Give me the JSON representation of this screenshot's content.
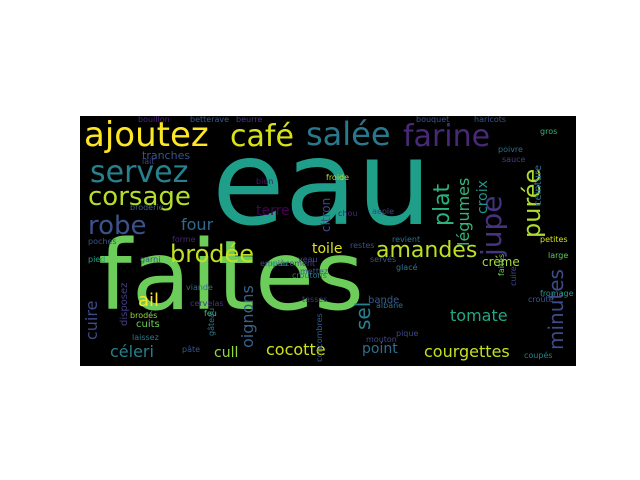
{
  "wordcloud": {
    "words": [
      {
        "text": "eau",
        "color": "#1f9e89"
      },
      {
        "text": "faites",
        "color": "#6ccd5a"
      },
      {
        "text": "ajoutez",
        "color": "#fde725"
      },
      {
        "text": "café",
        "color": "#d8e219"
      },
      {
        "text": "salée",
        "color": "#2a788e"
      },
      {
        "text": "farine",
        "color": "#482878"
      },
      {
        "text": "servez",
        "color": "#26828e"
      },
      {
        "text": "corsage",
        "color": "#b5de2b"
      },
      {
        "text": "robe",
        "color": "#3b528b"
      },
      {
        "text": "brodée",
        "color": "#c2df23"
      },
      {
        "text": "four",
        "color": "#31688e"
      },
      {
        "text": "amandes",
        "color": "#bddf26"
      },
      {
        "text": "purée",
        "color": "#addc30"
      },
      {
        "text": "jupe",
        "color": "#46327e"
      },
      {
        "text": "plat",
        "color": "#2db27d"
      },
      {
        "text": "légumes",
        "color": "#35b779"
      },
      {
        "text": "minutes",
        "color": "#3e4a89"
      },
      {
        "text": "sel",
        "color": "#26828e"
      },
      {
        "text": "terre",
        "color": "#440154"
      },
      {
        "text": "toile",
        "color": "#dde318"
      },
      {
        "text": "crème",
        "color": "#a5db36"
      },
      {
        "text": "croix",
        "color": "#1f968b"
      },
      {
        "text": "cuire",
        "color": "#3e4a89"
      },
      {
        "text": "ail",
        "color": "#fde725"
      },
      {
        "text": "oignons",
        "color": "#34618d"
      },
      {
        "text": "tomate",
        "color": "#22a884"
      },
      {
        "text": "céleri",
        "color": "#277f8e"
      },
      {
        "text": "cocotte",
        "color": "#d0e11c"
      },
      {
        "text": "point",
        "color": "#2e6f8e"
      },
      {
        "text": "courgettes",
        "color": "#c5e021"
      },
      {
        "text": "cull",
        "color": "#95d840"
      },
      {
        "text": "tranches",
        "color": "#3b528b"
      },
      {
        "text": "citron",
        "color": "#3e4a89"
      },
      {
        "text": "bande",
        "color": "#365c8d"
      },
      {
        "text": "cuits",
        "color": "#6ece58"
      },
      {
        "text": "disposez",
        "color": "#433e85"
      },
      {
        "text": "ceinture",
        "color": "#2c728e"
      },
      {
        "text": "bouillon",
        "color": "#482677"
      },
      {
        "text": "betterave",
        "color": "#365c8d"
      },
      {
        "text": "haricots",
        "color": "#39568c"
      },
      {
        "text": "bouquet",
        "color": "#39558c"
      },
      {
        "text": "tasses",
        "color": "#453882"
      },
      {
        "text": "froide",
        "color": "#b8de29"
      },
      {
        "text": "chou",
        "color": "#482173"
      },
      {
        "text": "bien",
        "color": "#48186a"
      },
      {
        "text": "veau",
        "color": "#3f4788"
      },
      {
        "text": "large",
        "color": "#5ec962"
      },
      {
        "text": "fromage",
        "color": "#1f9a8a"
      },
      {
        "text": "petites",
        "color": "#d5e21a"
      },
      {
        "text": "poivre",
        "color": "#2d708e"
      },
      {
        "text": "sauce",
        "color": "#433d84"
      },
      {
        "text": "croûte",
        "color": "#38598c"
      },
      {
        "text": "gros",
        "color": "#32b67a"
      },
      {
        "text": "servés",
        "color": "#3b528b"
      },
      {
        "text": "glacé",
        "color": "#2a788e"
      },
      {
        "text": "empiècement",
        "color": "#414487"
      },
      {
        "text": "mouton",
        "color": "#3e4989"
      },
      {
        "text": "viande",
        "color": "#2f6c8e"
      },
      {
        "text": "brodés",
        "color": "#8fd744"
      },
      {
        "text": "poches",
        "color": "#3b528b"
      },
      {
        "text": "broderie",
        "color": "#35608d"
      },
      {
        "text": "pied",
        "color": "#20a486"
      },
      {
        "text": "laissez",
        "color": "#2a788e"
      },
      {
        "text": "cervelas",
        "color": "#453581"
      },
      {
        "text": "feu",
        "color": "#4ac16d"
      },
      {
        "text": "gâteau",
        "color": "#297b8e"
      },
      {
        "text": "peau",
        "color": "#21a685"
      },
      {
        "text": "restes",
        "color": "#3d4d8a"
      },
      {
        "text": "revient",
        "color": "#2d718e"
      },
      {
        "text": "beurre",
        "color": "#443983"
      },
      {
        "text": "lait",
        "color": "#424086"
      },
      {
        "text": "aeple",
        "color": "#404588"
      },
      {
        "text": "faites",
        "color": "#6ccd5a"
      },
      {
        "text": "cuire",
        "color": "#3e4a89"
      },
      {
        "text": "coupés",
        "color": "#25848e"
      },
      {
        "text": "pâte",
        "color": "#3a548c"
      },
      {
        "text": "forme",
        "color": "#482475"
      },
      {
        "text": "mettez",
        "color": "#3b528b"
      },
      {
        "text": "garni",
        "color": "#3b518b"
      },
      {
        "text": "concombres",
        "color": "#375a8c"
      },
      {
        "text": "albane",
        "color": "#2e6e8e"
      },
      {
        "text": "croutons",
        "color": "#2a768e"
      },
      {
        "text": "pique",
        "color": "#3f4889"
      }
    ]
  }
}
